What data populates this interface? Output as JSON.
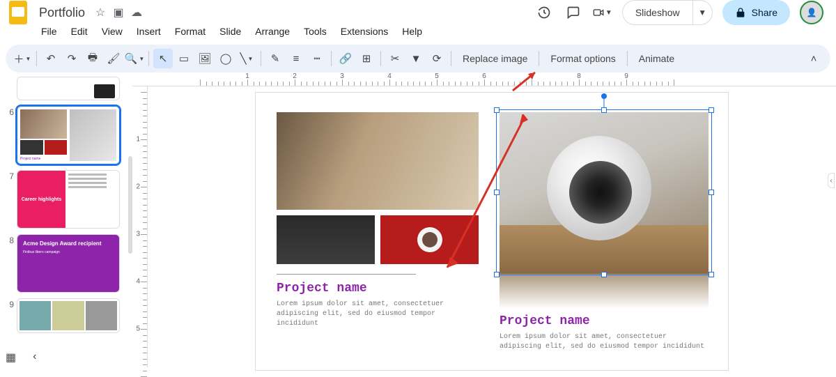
{
  "app": {
    "title": "Portfolio"
  },
  "title_icons": {
    "star": "☆",
    "folder": "▣",
    "cloud": "☁"
  },
  "menu": [
    "File",
    "Edit",
    "View",
    "Insert",
    "Format",
    "Slide",
    "Arrange",
    "Tools",
    "Extensions",
    "Help"
  ],
  "right_buttons": {
    "history": "↻",
    "comments": "💬",
    "present_cam": "📷",
    "slideshow": "Slideshow",
    "share": "Share"
  },
  "toolbar_text": {
    "replace_image": "Replace image",
    "format_options": "Format options",
    "animate": "Animate"
  },
  "ruler_h": [
    1,
    2,
    3,
    4,
    5,
    6,
    7,
    8,
    9
  ],
  "ruler_v": [
    1,
    2,
    3,
    4,
    5
  ],
  "thumbs": [
    {
      "num": "6",
      "kind": "portfolio",
      "active": true
    },
    {
      "num": "7",
      "kind": "career",
      "label": "Career highlights"
    },
    {
      "num": "8",
      "kind": "award",
      "label": "Acme Design Award recipient",
      "sub": "Finibus libero campaign"
    },
    {
      "num": "9",
      "kind": "strip"
    }
  ],
  "slide": {
    "left": {
      "title": "Project name",
      "body": "Lorem ipsum dolor sit amet, consectetuer adipiscing elit, sed do eiusmod tempor incididunt"
    },
    "right": {
      "title": "Project name",
      "body": "Lorem ipsum dolor sit amet, consectetuer adipiscing elit, sed do eiusmod tempor incididunt"
    }
  }
}
